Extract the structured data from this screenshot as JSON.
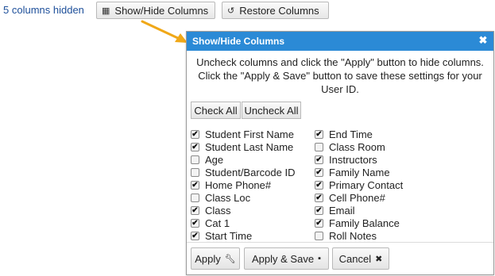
{
  "toolbar": {
    "hidden_count": "5 columns hidden",
    "show_hide_label": "Show/Hide Columns",
    "show_hide_icon": "table-icon",
    "restore_label": "Restore Columns",
    "restore_icon": "undo-icon"
  },
  "dialog": {
    "title": "Show/Hide Columns",
    "close_icon": "close-icon",
    "description": "Uncheck columns and click the \"Apply\" button to hide columns. Click the \"Apply & Save\" button to save these settings for your User ID.",
    "check_all_label": "Check All",
    "uncheck_all_label": "Uncheck All",
    "left_columns": [
      {
        "label": "Student First Name",
        "checked": true
      },
      {
        "label": "Student Last Name",
        "checked": true
      },
      {
        "label": "Age",
        "checked": false
      },
      {
        "label": "Student/Barcode ID",
        "checked": false
      },
      {
        "label": "Home Phone#",
        "checked": true
      },
      {
        "label": "Class Loc",
        "checked": false
      },
      {
        "label": "Class",
        "checked": true
      },
      {
        "label": "Cat 1",
        "checked": true
      },
      {
        "label": "Start Time",
        "checked": true
      }
    ],
    "right_columns": [
      {
        "label": "End Time",
        "checked": true
      },
      {
        "label": "Class Room",
        "checked": false
      },
      {
        "label": "Instructors",
        "checked": true
      },
      {
        "label": "Family Name",
        "checked": true
      },
      {
        "label": "Primary Contact",
        "checked": true
      },
      {
        "label": "Cell Phone#",
        "checked": true
      },
      {
        "label": "Email",
        "checked": true
      },
      {
        "label": "Family Balance",
        "checked": true
      },
      {
        "label": "Roll Notes",
        "checked": false
      }
    ],
    "apply_label": "Apply",
    "apply_icon": "wrench-icon",
    "apply_save_label": "Apply & Save",
    "apply_save_icon": "save-icon",
    "cancel_label": "Cancel",
    "cancel_icon": "close-icon"
  },
  "colors": {
    "title_bar": "#2b8ad6",
    "hidden_count_text": "#1d4f9a",
    "annotation_arrow": "#f0a818"
  }
}
